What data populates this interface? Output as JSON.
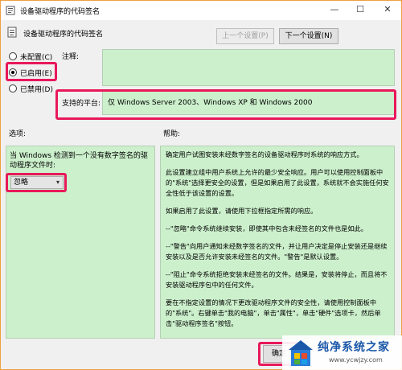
{
  "window": {
    "title": "设备驱动程序的代码签名",
    "controls": [
      "—",
      "☐",
      "✕"
    ]
  },
  "header": {
    "policy_title": "设备驱动程序的代码签名",
    "prev_button": "上一个设置(P)",
    "next_button": "下一个设置(N)"
  },
  "state": {
    "options": [
      {
        "label": "未配置(C)",
        "selected": false
      },
      {
        "label": "已启用(E)",
        "selected": true
      },
      {
        "label": "已禁用(D)",
        "selected": false
      }
    ]
  },
  "comment_label": "注释:",
  "supported": {
    "label": "支持的平台:",
    "value": "仅 Windows Server 2003、Windows XP 和 Windows 2000"
  },
  "options_pane": {
    "heading": "选项:",
    "prompt": "当 Windows 检测到一个没有数字签名的驱动程序文件时:",
    "selected_value": "忽略"
  },
  "help_pane": {
    "heading": "帮助:",
    "paragraphs": [
      "确定用户试图安装未经数字签名的设备驱动程序时系统的响应方式。",
      "此设置建立组中用户系统上允许的最少安全响应。用户可以使用控制面板中的\"系统\"选择更安全的设置，但是如果启用了此设置，系统就不会实施任何安全性低于该设置的设置。",
      "如果启用了此设置，请使用下拉框指定所需的响应。",
      "--\"忽略\"命令系统继续安装，即使其中包含未经签名的文件也是如此。",
      "--\"警告\"向用户通知未经数字签名的文件，并让用户决定是停止安装还是继续安装以及是否允许安装未经签名的文件。\"警告\"是默认设置。",
      "--\"阻止\"命令系统拒绝安装未经签名的文件。结果是，安装将停止，而且将不安装驱动程序包中的任何文件。",
      "要在不指定设置的情况下更改驱动程序文件的安全性，请使用控制面板中的\"系统\"。右键单击\"我的电脑\"，单击\"属性\"，单击\"硬件\"选项卡，然后单击\"驱动程序签名\"按钮。"
    ]
  },
  "footer": {
    "ok_button": "确定"
  },
  "watermark": {
    "title": "纯净系统之家",
    "url": "www.ycwjzy.com"
  },
  "colors": {
    "highlight": "#e8185a",
    "green_panel": "#ccf0cc",
    "window_border": "#f0a040"
  }
}
